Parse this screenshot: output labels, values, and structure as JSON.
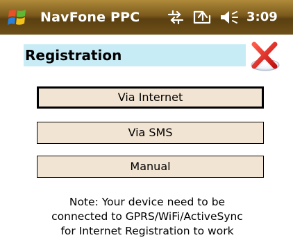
{
  "titlebar": {
    "title": "NavFone PPC",
    "time": "3:09",
    "start_icon": "windows-flag-icon",
    "status_icons": [
      "connectivity-icon",
      "sync-icon",
      "volume-icon"
    ]
  },
  "main": {
    "header": "Registration",
    "close_icon": "red-x-icon",
    "buttons": {
      "internet": "Via Internet",
      "sms": "Via SMS",
      "manual": "Manual"
    },
    "note": {
      "line1": "Note: Your device need to be",
      "line2": "connected to GPRS/WiFi/ActiveSync",
      "line3": "for Internet Registration to work"
    }
  },
  "colors": {
    "header_bg": "#c8ecf6",
    "button_bg": "#f2e4d2",
    "titlebar": "#7a5a1c",
    "close_red": "#e02020"
  }
}
